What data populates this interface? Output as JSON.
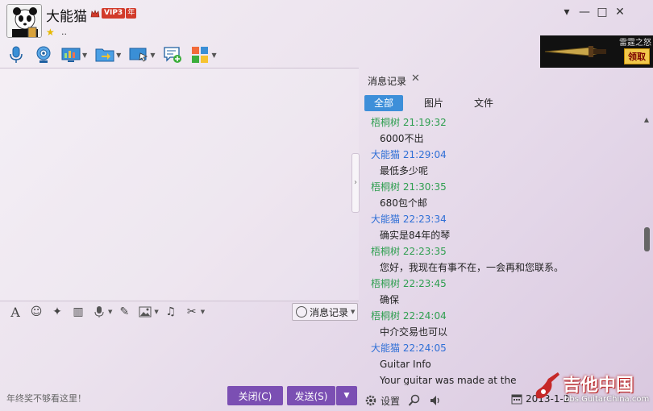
{
  "window": {
    "nickname": "大能猫",
    "vip_label": "VIP3",
    "vip_year": "年",
    "signature": "..",
    "controls": [
      "▾",
      "—",
      "□",
      "✕"
    ]
  },
  "toolbar": {
    "items": [
      {
        "icon": "microphone-icon",
        "has_dropdown": false
      },
      {
        "icon": "webcam-icon",
        "has_dropdown": false
      },
      {
        "icon": "screen-share-icon",
        "has_dropdown": true
      },
      {
        "icon": "file-transfer-icon",
        "has_dropdown": true
      },
      {
        "icon": "remote-assist-icon",
        "has_dropdown": true
      },
      {
        "icon": "add-chat-icon",
        "has_dropdown": false
      },
      {
        "icon": "apps-grid-icon",
        "has_dropdown": true
      }
    ]
  },
  "ad": {
    "title": "雷霆之怒",
    "button": "领取"
  },
  "format_bar": {
    "history_label": "消息记录"
  },
  "input": {
    "tip": "年终奖不够看这里！",
    "close_label": "关闭(C)",
    "send_label": "发送(S)"
  },
  "history": {
    "tab_label": "消息记录",
    "subtabs": [
      "全部",
      "图片",
      "文件"
    ],
    "messages": [
      {
        "sender": "梧桐树",
        "time": "21:19:32",
        "color": "green",
        "text": "6000不出"
      },
      {
        "sender": "大能猫",
        "time": "21:29:04",
        "color": "blue",
        "text": "最低多少呢"
      },
      {
        "sender": "梧桐树",
        "time": "21:30:35",
        "color": "green",
        "text": "680包个邮"
      },
      {
        "sender": "大能猫",
        "time": "22:23:34",
        "color": "blue",
        "text": "确实是84年的琴"
      },
      {
        "sender": "梧桐树",
        "time": "22:23:35",
        "color": "green",
        "text": "您好，我现在有事不在，一会再和您联系。"
      },
      {
        "sender": "梧桐树",
        "time": "22:23:45",
        "color": "green",
        "text": "确保"
      },
      {
        "sender": "梧桐树",
        "time": "22:24:04",
        "color": "green",
        "text": "中介交易也可以"
      },
      {
        "sender": "大能猫",
        "time": "22:24:05",
        "color": "blue",
        "text": "Guitar Info",
        "text2": "Your guitar was made at the"
      }
    ],
    "settings_label": "设置",
    "date": "2013-1-2"
  },
  "watermark": {
    "main": "吉他中国",
    "sub": "bbs.GuitarChina.com"
  },
  "colors": {
    "accent_purple": "#7b4fb3",
    "tab_blue": "#3d8fd9",
    "sender_green": "#2e9e4f",
    "sender_blue": "#2f6fd6"
  }
}
